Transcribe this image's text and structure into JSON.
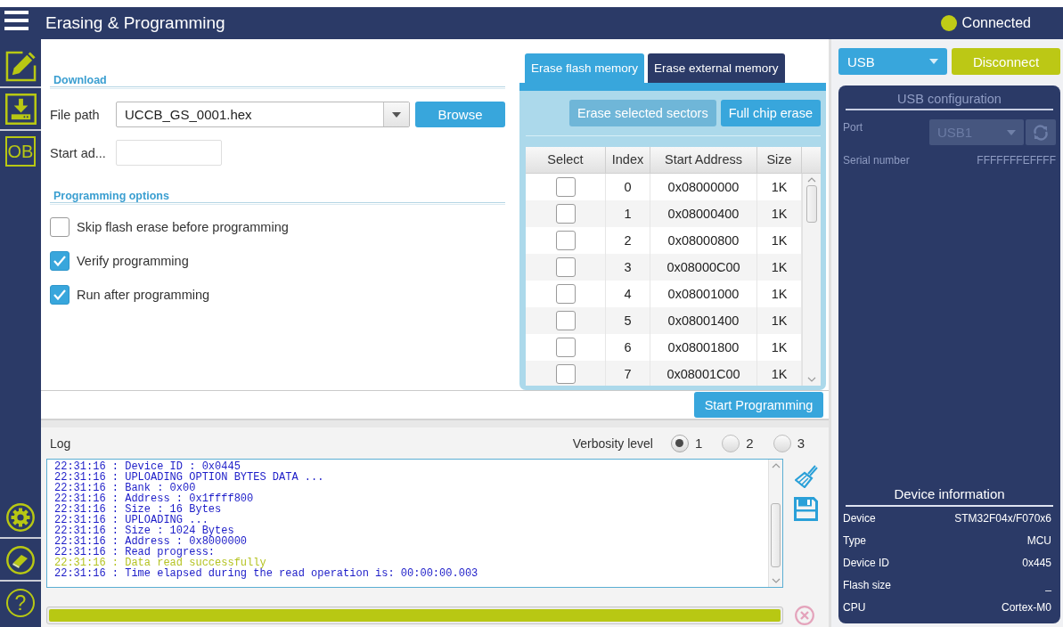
{
  "header": {
    "title": "Erasing & Programming",
    "status": {
      "label": "Connected",
      "connected": true
    }
  },
  "sidebar": {
    "top_items": [
      {
        "kind": "edit"
      },
      {
        "kind": "download"
      },
      {
        "kind": "option_bytes",
        "label": "OB"
      }
    ],
    "bottom_items": [
      {
        "kind": "settings"
      },
      {
        "kind": "eraser"
      },
      {
        "kind": "help",
        "label": "?"
      }
    ]
  },
  "download": {
    "title": "Download",
    "file_path": {
      "label": "File path",
      "value": "UCCB_GS_0001.hex"
    },
    "browse_button": "Browse",
    "start_address": {
      "label": "Start ad..."
    }
  },
  "programming_options": {
    "title": "Programming options",
    "options": [
      {
        "label": "Skip flash erase before programming",
        "checked": false
      },
      {
        "label": "Verify programming",
        "checked": true
      },
      {
        "label": "Run after programming",
        "checked": true
      }
    ]
  },
  "erase": {
    "tabs": [
      {
        "label": "Erase flash memory",
        "selected": true
      },
      {
        "label": "Erase external memory",
        "selected": false
      }
    ],
    "buttons": [
      {
        "label": "Erase selected sectors",
        "disabled": true
      },
      {
        "label": "Full chip erase",
        "disabled": false
      }
    ],
    "table": {
      "columns": [
        "Select",
        "Index",
        "Start Address",
        "Size"
      ],
      "rows": [
        {
          "checked": false,
          "index": "0",
          "start_address": "0x08000000",
          "size": "1K"
        },
        {
          "checked": false,
          "index": "1",
          "start_address": "0x08000400",
          "size": "1K"
        },
        {
          "checked": false,
          "index": "2",
          "start_address": "0x08000800",
          "size": "1K"
        },
        {
          "checked": false,
          "index": "3",
          "start_address": "0x08000C00",
          "size": "1K"
        },
        {
          "checked": false,
          "index": "4",
          "start_address": "0x08001000",
          "size": "1K"
        },
        {
          "checked": false,
          "index": "5",
          "start_address": "0x08001400",
          "size": "1K"
        },
        {
          "checked": false,
          "index": "6",
          "start_address": "0x08001800",
          "size": "1K"
        },
        {
          "checked": false,
          "index": "7",
          "start_address": "0x08001C00",
          "size": "1K"
        }
      ]
    }
  },
  "start_button": "Start Programming",
  "log": {
    "title": "Log",
    "verbosity": {
      "label": "Verbosity level",
      "options": [
        {
          "label": "1",
          "selected": true
        },
        {
          "label": "2",
          "selected": false
        },
        {
          "label": "3",
          "selected": false
        }
      ]
    },
    "lines": [
      {
        "text": "22:31:16 : Device ID : 0x0445",
        "color": "#1c1cc8"
      },
      {
        "text": "22:31:16 : UPLOADING OPTION BYTES DATA ...",
        "color": "#1c1cc8"
      },
      {
        "text": "22:31:16 : Bank : 0x00",
        "color": "#1c1cc8"
      },
      {
        "text": "22:31:16 : Address : 0x1ffff800",
        "color": "#1c1cc8"
      },
      {
        "text": "22:31:16 : Size : 16 Bytes",
        "color": "#1c1cc8"
      },
      {
        "text": "22:31:16 : UPLOADING ...",
        "color": "#1c1cc8"
      },
      {
        "text": "22:31:16 : Size : 1024 Bytes",
        "color": "#1c1cc8"
      },
      {
        "text": "22:31:16 : Address : 0x8000000",
        "color": "#1c1cc8"
      },
      {
        "text": "22:31:16 : Read progress:",
        "color": "#1c1cc8"
      },
      {
        "text": "22:31:16 : Data read successfully",
        "color": "#b5c322"
      },
      {
        "text": "22:31:16 : Time elapsed during the read operation is: 00:00:00.003",
        "color": "#1c1cc8"
      }
    ],
    "progress": {
      "level": 1
    }
  },
  "connection": {
    "interface": "USB",
    "button": "Disconnect",
    "config": {
      "title": "USB configuration",
      "port": {
        "label": "Port",
        "value": "USB1",
        "disabled": true
      },
      "serial": {
        "label": "Serial number",
        "value": "FFFFFFFEFFFF"
      }
    },
    "device_info": {
      "title": "Device information",
      "rows": [
        {
          "label": "Device",
          "value": "STM32F04x/F070x6"
        },
        {
          "label": "Type",
          "value": "MCU"
        },
        {
          "label": "Device ID",
          "value": "0x445"
        },
        {
          "label": "Flash size",
          "value": "_"
        },
        {
          "label": "CPU",
          "value": "Cortex-M0"
        }
      ]
    }
  }
}
